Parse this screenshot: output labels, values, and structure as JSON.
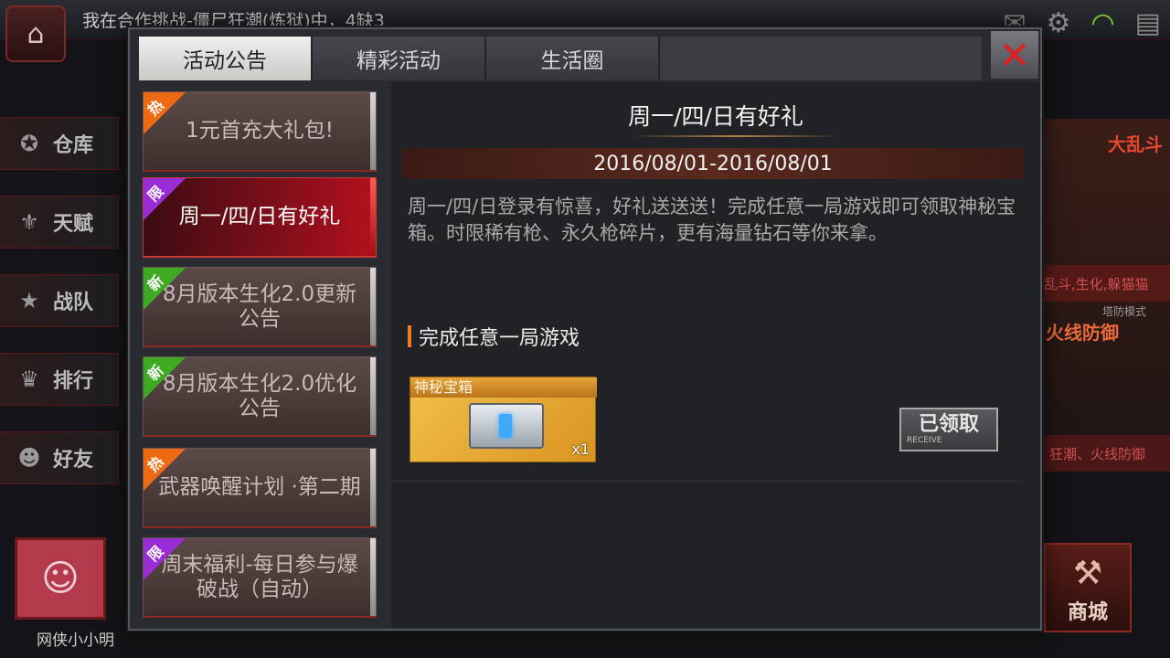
{
  "background": {
    "ticker": "我在合作挑战-僵尸狂潮(炼狱)中，4缺3",
    "home_icon": "home-icon",
    "side_menu": [
      {
        "label": "仓库",
        "icon": "warehouse-icon",
        "glyph": "✪"
      },
      {
        "label": "天赋",
        "icon": "talent-icon",
        "glyph": "⚜"
      },
      {
        "label": "战队",
        "icon": "clan-star-icon",
        "glyph": "★"
      },
      {
        "label": "排行",
        "icon": "trophy-icon",
        "glyph": "♛"
      },
      {
        "label": "好友",
        "icon": "friends-icon",
        "glyph": "☻"
      }
    ],
    "player_name": "网侠小小明",
    "right_panel": {
      "title": "大乱斗",
      "caption1": "乱斗,生化,躲猫猫",
      "mode_sub": "塔防模式",
      "title2": "火线防御",
      "caption2": "狂潮、火线防御"
    },
    "shop_label": "商城"
  },
  "tabs": [
    {
      "label": "活动公告",
      "active": true
    },
    {
      "label": "精彩活动",
      "active": false
    },
    {
      "label": "生活圈",
      "active": false
    }
  ],
  "close_icon": "close-icon",
  "events": [
    {
      "badge": "热",
      "badge_type": "hot",
      "title": "1元首充大礼包!",
      "active": false
    },
    {
      "badge": "限",
      "badge_type": "limit",
      "title": "周一/四/日有好礼",
      "active": true
    },
    {
      "badge": "新",
      "badge_type": "new",
      "title": "8月版本生化2.0更新公告",
      "active": false
    },
    {
      "badge": "新",
      "badge_type": "new",
      "title": "8月版本生化2.0优化公告",
      "active": false
    },
    {
      "badge": "热",
      "badge_type": "hot",
      "title": "武器唤醒计划 ·第二期",
      "active": false
    },
    {
      "badge": "限",
      "badge_type": "limit",
      "title": "周末福利-每日参与爆破战（自动）",
      "active": false
    }
  ],
  "detail": {
    "title": "周一/四/日有好礼",
    "date_range": "2016/08/01-2016/08/01",
    "description": "周一/四/日登录有惊喜，好礼送送送！完成任意一局游戏即可领取神秘宝箱。时限稀有枪、永久枪碎片，更有海量钻石等你来拿。",
    "task": "完成任意一局游戏",
    "reward": {
      "name": "神秘宝箱",
      "qty": "x1",
      "icon": "mystery-chest-icon"
    },
    "received": {
      "label": "已领取",
      "sub": "RECEIVE"
    }
  }
}
